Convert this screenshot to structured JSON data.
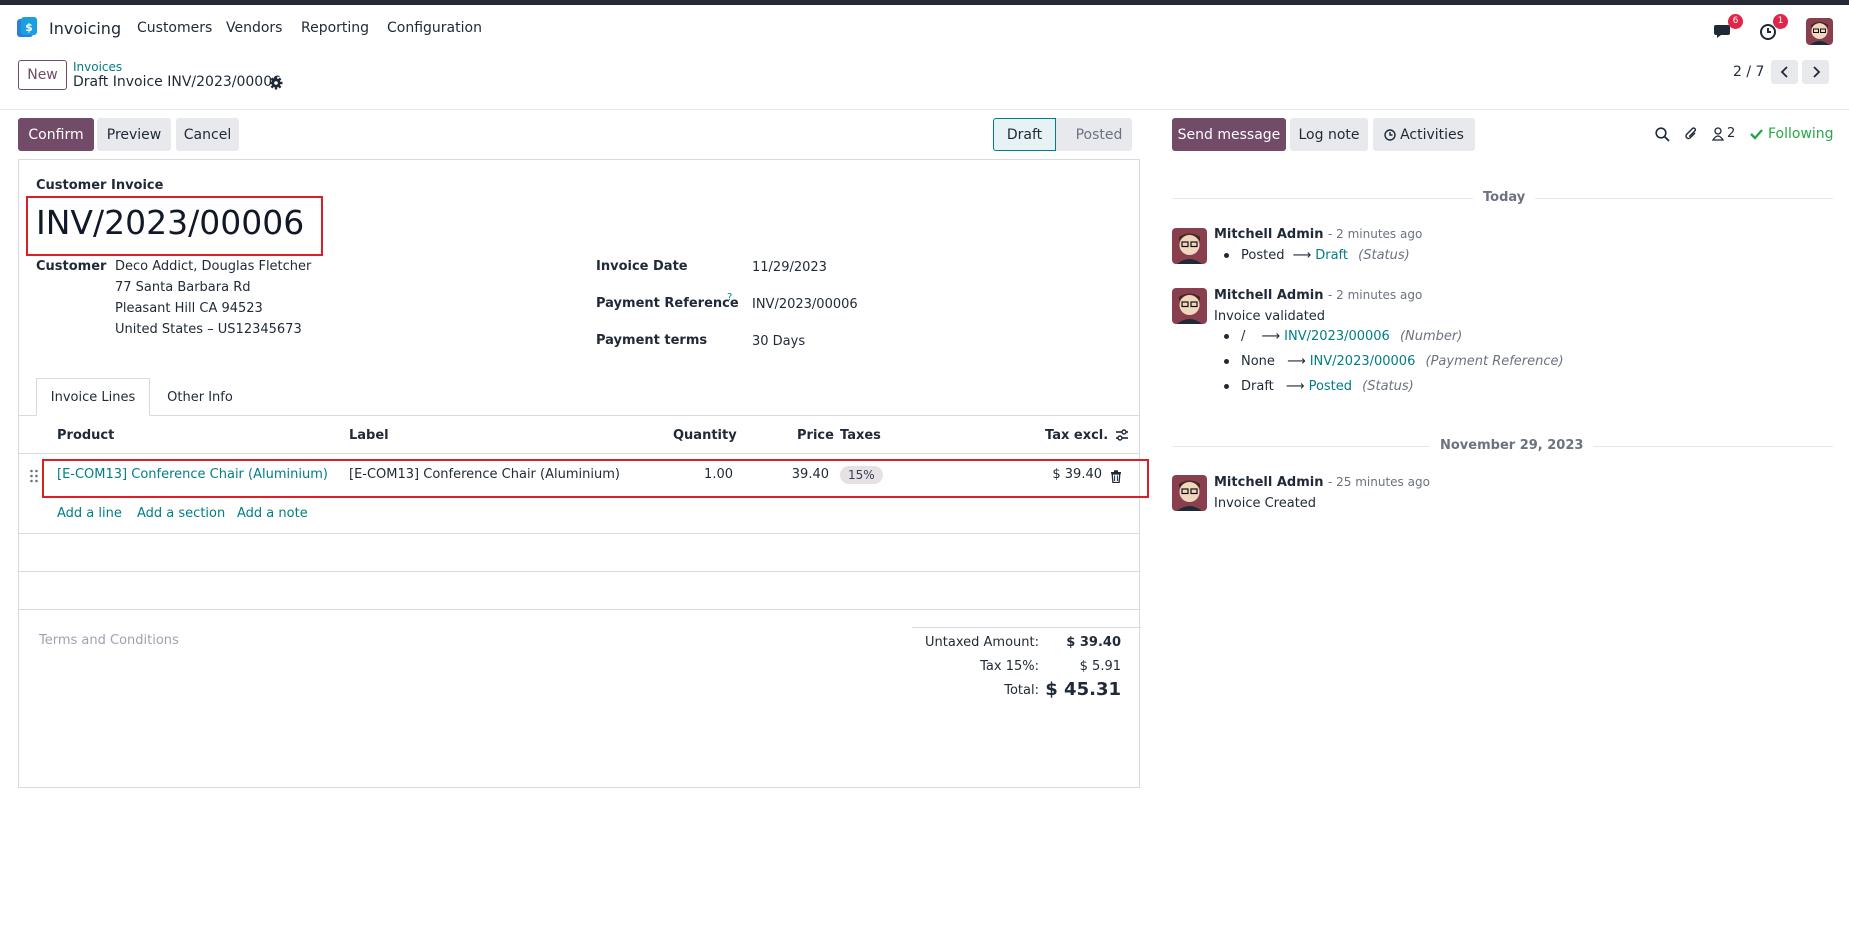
{
  "navbar": {
    "app_name": "Invoicing",
    "menu": [
      "Customers",
      "Vendors",
      "Reporting",
      "Configuration"
    ],
    "messages_count": "6",
    "activities_count": "1"
  },
  "control_panel": {
    "new_label": "New",
    "breadcrumb_parent": "Invoices",
    "breadcrumb_current": "Draft Invoice INV/2023/00006",
    "pager": "2 / 7"
  },
  "actions": {
    "confirm": "Confirm",
    "preview": "Preview",
    "cancel": "Cancel"
  },
  "statusbar": {
    "active": "Draft",
    "inactive": "Posted"
  },
  "invoice": {
    "type": "Customer Invoice",
    "name": "INV/2023/00006",
    "customer_label": "Customer",
    "customer_name": "Deco Addict, Douglas Fletcher",
    "address_1": "77 Santa Barbara Rd",
    "address_2": "Pleasant Hill CA 94523",
    "address_3": "United States – US12345673",
    "invoice_date_label": "Invoice Date",
    "invoice_date": "11/29/2023",
    "payment_ref_label": "Payment Reference",
    "payment_ref_help": "?",
    "payment_ref": "INV/2023/00006",
    "payment_terms_label": "Payment terms",
    "payment_terms": "30 Days"
  },
  "tabs": [
    "Invoice Lines",
    "Other Info"
  ],
  "lines": {
    "headers": {
      "product": "Product",
      "label": "Label",
      "quantity": "Quantity",
      "price": "Price",
      "taxes": "Taxes",
      "tax_excl": "Tax excl."
    },
    "rows": [
      {
        "product": "[E-COM13] Conference Chair (Aluminium)",
        "label": "[E-COM13] Conference Chair (Aluminium)",
        "quantity": "1.00",
        "price": "39.40",
        "tax": "15%",
        "subtotal": "$ 39.40"
      }
    ],
    "add_line": "Add a line",
    "add_section": "Add a section",
    "add_note": "Add a note"
  },
  "terms_placeholder": "Terms and Conditions",
  "totals": {
    "untaxed_label": "Untaxed Amount:",
    "untaxed": "$ 39.40",
    "tax_label": "Tax 15%:",
    "tax": "$ 5.91",
    "total_label": "Total:",
    "total": "$ 45.31"
  },
  "chatter": {
    "send_message": "Send message",
    "log_note": "Log note",
    "activities": "Activities",
    "followers_count": "2",
    "following": "Following",
    "date_today": "Today",
    "date_nov": "November 29, 2023",
    "messages": [
      {
        "author": "Mitchell Admin",
        "time": "- 2 minutes ago",
        "changes": [
          {
            "old": "Posted",
            "new": "Draft",
            "field": "(Status)"
          }
        ]
      },
      {
        "author": "Mitchell Admin",
        "time": "- 2 minutes ago",
        "body": "Invoice validated",
        "changes": [
          {
            "old": "/",
            "new": "INV/2023/00006",
            "field": "(Number)"
          },
          {
            "old": "None",
            "new": "INV/2023/00006",
            "field": "(Payment Reference)"
          },
          {
            "old": "Draft",
            "new": "Posted",
            "field": "(Status)"
          }
        ]
      },
      {
        "author": "Mitchell Admin",
        "time": "- 25 minutes ago",
        "body": "Invoice Created"
      }
    ]
  },
  "colors": {
    "primary": "#714b67",
    "link": "#017e84",
    "highlight_border": "#dc1f26",
    "following": "#28a745"
  }
}
